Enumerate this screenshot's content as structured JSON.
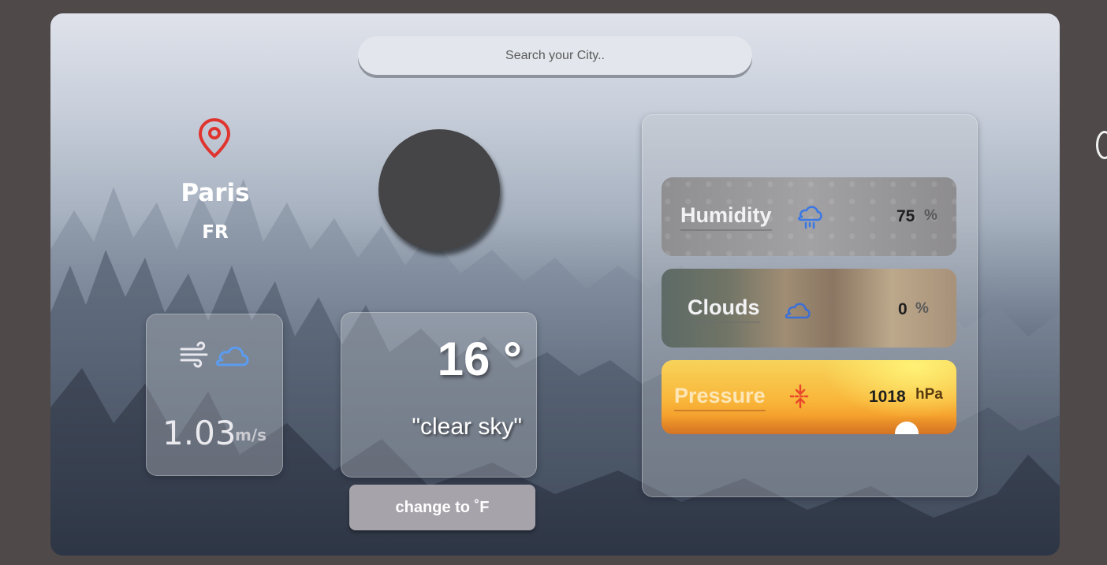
{
  "search": {
    "placeholder": "Search your City.."
  },
  "location": {
    "city": "Paris",
    "country": "FR",
    "icon": "map-pin-icon",
    "icon_color": "#e0342f"
  },
  "wind": {
    "value": "1.03",
    "unit": "m/s",
    "icons": [
      "wind-icon",
      "cloud-icon"
    ],
    "cloud_color": "#5b9cf0"
  },
  "weather": {
    "temperature": "16 °",
    "description": "\"clear sky\"",
    "toggle_label": "change to ˚F"
  },
  "stats": {
    "humidity": {
      "label": "Humidity",
      "value": "75",
      "unit": "%",
      "icon": "rain-cloud-icon",
      "icon_color": "#3a78e6"
    },
    "clouds": {
      "label": "Clouds",
      "value": "0",
      "unit": "%",
      "icon": "cloud-icon",
      "icon_color": "#3a6fd8"
    },
    "pressure": {
      "label": "Pressure",
      "value": "1018",
      "unit": "hPa",
      "icon": "compress-arrows-icon",
      "icon_color": "#e8472b"
    }
  }
}
